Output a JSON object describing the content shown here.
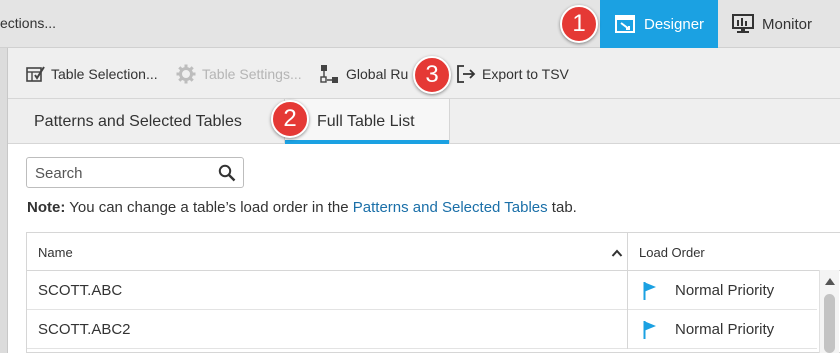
{
  "header": {
    "breadcrumb": "ections...",
    "designer_label": "Designer",
    "monitor_label": "Monitor"
  },
  "toolbar": {
    "table_selection": "Table Selection...",
    "table_settings": "Table Settings...",
    "global_rules": "Global Ru",
    "export": "Export to TSV"
  },
  "tabs": {
    "patterns": "Patterns and Selected Tables",
    "full": "Full Table List"
  },
  "search": {
    "placeholder": "Search"
  },
  "note": {
    "bold": "Note:",
    "text_before": " You can change a table’s load order in the ",
    "link": "Patterns and Selected Tables",
    "text_after": " tab."
  },
  "table": {
    "columns": [
      "Name",
      "Load Order"
    ],
    "rows": [
      {
        "name": "SCOTT.ABC",
        "load_order": "Normal Priority"
      },
      {
        "name": "SCOTT.ABC2",
        "load_order": "Normal Priority"
      }
    ]
  },
  "callouts": [
    "1",
    "2",
    "3"
  ],
  "colors": {
    "accent": "#1ba1e2",
    "callout": "#e53935",
    "flag": "#1ba1e2"
  }
}
